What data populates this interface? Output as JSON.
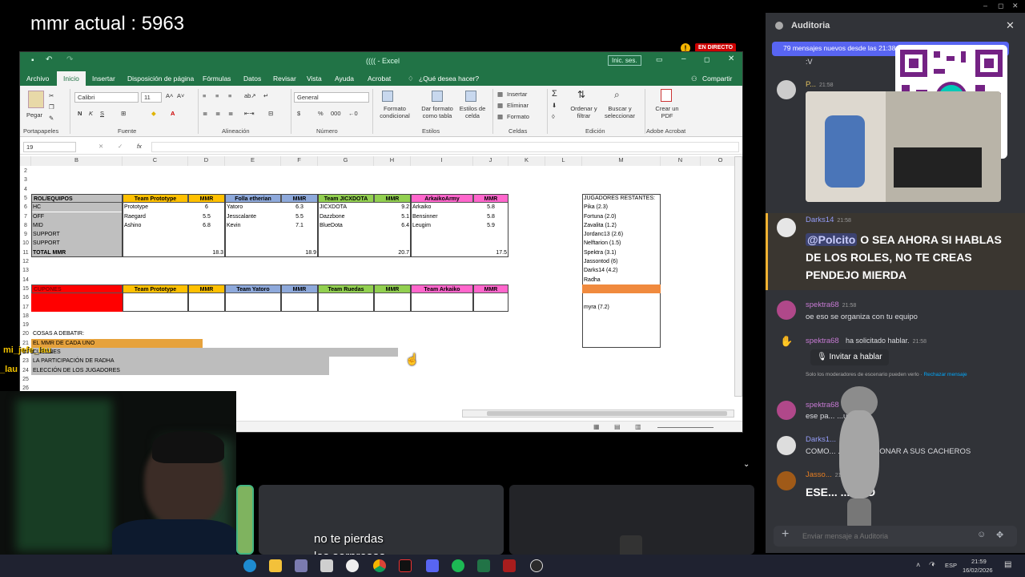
{
  "overlay": {
    "mmr_text": "mmr actual : 5963",
    "live_badge": "EN DIRECTO",
    "subtitle_line1": "no te pierdas",
    "subtitle_line2": "las sorpresas",
    "user_overlay": "mi_jefe_lau",
    "user_overlay2": "_lau"
  },
  "excel": {
    "title": "((((  -  Excel",
    "signin": "Inic. ses.",
    "tabs": [
      "Archivo",
      "Inicio",
      "Insertar",
      "Disposición de página",
      "Fórmulas",
      "Datos",
      "Revisar",
      "Vista",
      "Ayuda",
      "Acrobat",
      "¿Qué desea hacer?"
    ],
    "share": "Compartir",
    "ribbon": {
      "paste": "Pegar",
      "font_name": "Calibri",
      "font_size": "11",
      "number_format": "General",
      "conditional": "Formato condicional",
      "format_table": "Dar formato como tabla",
      "cell_styles": "Estilos de celda",
      "insert": "Insertar",
      "delete": "Eliminar",
      "format": "Formato",
      "sort": "Ordenar y filtrar",
      "find": "Buscar y seleccionar",
      "pdf": "Crear un PDF",
      "groups": [
        "Portapapeles",
        "Fuente",
        "Alineación",
        "Número",
        "Estilos",
        "Celdas",
        "Edición",
        "Adobe Acrobat"
      ]
    },
    "name_box": "19",
    "fx": "fx",
    "columns": [
      "B",
      "C",
      "D",
      "E",
      "F",
      "G",
      "H",
      "I",
      "J",
      "K",
      "L",
      "M",
      "N",
      "O"
    ],
    "rows": [
      "2",
      "3",
      "4",
      "5",
      "6",
      "7",
      "8",
      "9",
      "10",
      "11",
      "12",
      "13",
      "14",
      "15",
      "16",
      "17",
      "18",
      "19",
      "20",
      "21",
      "22",
      "23",
      "24",
      "25",
      "26"
    ],
    "table1": {
      "headers": [
        "ROL/EQUIPOS",
        "Team Prototype",
        "MMR",
        "Folla etherian",
        "MMR",
        "Team JICXDOTA",
        "MMR",
        "ArkaikoArmy",
        "MMR"
      ],
      "roles": [
        "HC",
        "OFF",
        "MID",
        "SUPPORT",
        "SUPPORT",
        "TOTAL MMR"
      ],
      "col_proto": [
        "Prototype",
        "Raegard",
        "Ashino"
      ],
      "mmr_proto": [
        "6",
        "5.5",
        "6.8"
      ],
      "col_folla": [
        "Yatoro",
        "Jesscalante",
        "Kevin"
      ],
      "mmr_folla": [
        "6.3",
        "5.5",
        "7.1"
      ],
      "col_jicx": [
        "JICXDOTA",
        "Dazzbone",
        "BlueDota"
      ],
      "mmr_jicx": [
        "9.2",
        "5.1",
        "6.4"
      ],
      "col_arka": [
        "Arkaiko",
        "Bensinner",
        "Leugim"
      ],
      "mmr_arka": [
        "5.8",
        "5.8",
        "5.9"
      ],
      "totals": [
        "18.3",
        "18.9",
        "20.7",
        "17.5"
      ]
    },
    "table2": {
      "headers": [
        "CUPONES",
        "Team Prototype",
        "MMR",
        "Team Yatoro",
        "MMR",
        "Team Ruedas",
        "MMR",
        "Team Arkaiko",
        "MMR"
      ]
    },
    "debate": [
      "COSAS A DEBATIR:",
      "EL MMR DE CADA UNO",
      "CUPONES",
      "LA PARTICIPACIÓN DE RADHA",
      "ELECCIÓN DE LOS JUGADORES"
    ],
    "remaining": {
      "title": "JUGADORES RESTANTES:",
      "items": [
        "Pika (2.3)",
        "Fortuna (2.0)",
        "Zavalita (1.2)",
        "Jordanc13 (2.6)",
        "Nelftarion (1.5)",
        "Spektra (3.1)",
        "Jassontod (6)",
        "Darks14 (4.2)",
        "Radha"
      ],
      "extra": "myra (7.2)"
    }
  },
  "discord": {
    "title": "Auditoria",
    "new_msgs": "79 mensajes nuevos desde las 21:38",
    "prev_text": ":V",
    "messages": [
      {
        "user": "P...",
        "time": "21:58",
        "text": ""
      },
      {
        "user": "Darks14",
        "time": "21:58",
        "mention": "@Polcito",
        "text": " O SEA AHORA SI HABLAS DE LOS ROLES, NO TE CREAS PENDEJO MIERDA"
      },
      {
        "user": "spektra68",
        "time": "21:58",
        "text": "oe eso se organiza con tu equipo"
      },
      {
        "user": "spektra68",
        "time": "21:58",
        "text": "ha solicitado hablar."
      },
      {
        "user": "spektra68",
        "time": "",
        "text": "ese pa... ...uedas"
      },
      {
        "user": "Darks1...",
        "time": "",
        "text": "COMO... ...TA MENCIONAR A SUS CACHEROS"
      },
      {
        "user": "Jasso...",
        "time": "21:59",
        "text": "ESE... ...OCO"
      }
    ],
    "invite_btn": "Invitar a hablar",
    "mod_note": "Solo los moderadores de escenario pueden verlo",
    "reject": "Rechazar mensaje",
    "input_placeholder": "Enviar mensaje a Auditoria"
  },
  "taskbar": {
    "lang": "ESP",
    "time": "21:59",
    "date": "16/02/2026"
  },
  "colors": {
    "excel_green": "#217346",
    "yellow": "#ffc000",
    "blue": "#8ea9db",
    "green": "#92d050",
    "pink": "#ff66cc",
    "red": "#ff0000",
    "orange": "#f4b183",
    "discord_bg": "#313338"
  }
}
